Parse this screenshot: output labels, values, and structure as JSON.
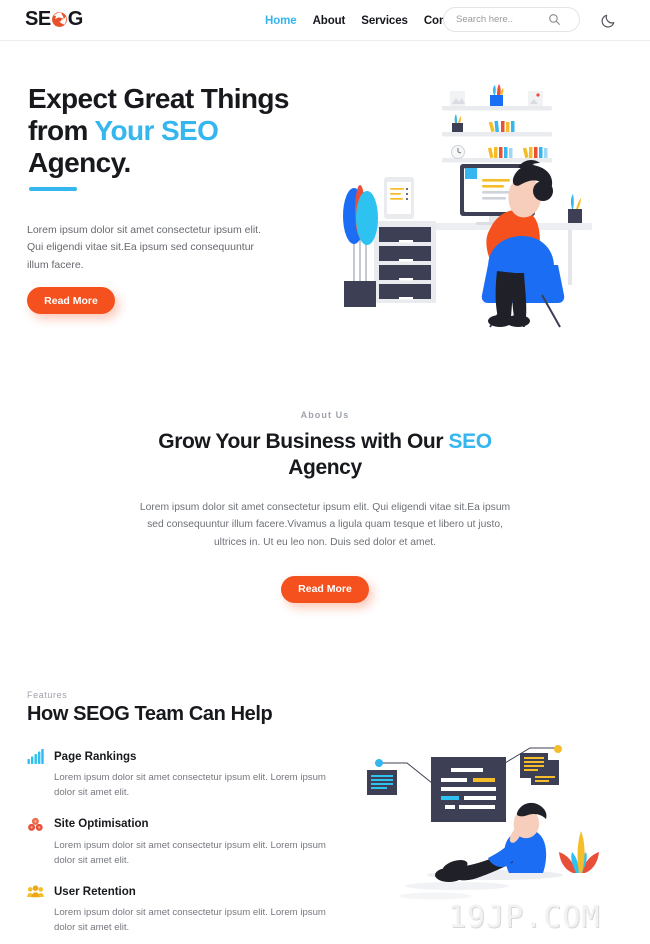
{
  "colors": {
    "accent_orange": "#f4511e",
    "accent_blue": "#35b6ef",
    "heading_dark": "#17191d",
    "body_gray": "#6e7178",
    "eyebrow_gray": "#9ea2ab",
    "background": "#ffffff",
    "icon_yellow": "#f5bd2a",
    "icon_red": "#e8503a",
    "illustration_dark": "#3d4054"
  },
  "header": {
    "logo": {
      "pre": "SE",
      "mark": "o-mark-icon",
      "post": "G",
      "full": "SEOG"
    },
    "nav": [
      {
        "label": "Home",
        "active": true
      },
      {
        "label": "About",
        "active": false
      },
      {
        "label": "Services",
        "active": false
      },
      {
        "label": "Contact",
        "active": false
      }
    ],
    "search": {
      "placeholder": "Search here..",
      "value": "",
      "icon": "search-icon"
    },
    "theme_toggle": {
      "icon": "moon-icon",
      "label": "Dark mode"
    }
  },
  "hero": {
    "title_line1": "Expect Great Things",
    "title_line2_plain": "from ",
    "title_line2_highlight": "Your SEO",
    "title_line3": "Agency.",
    "paragraph": "Lorem ipsum dolor sit amet consectetur ipsum elit. Qui eligendi vitae sit.Ea ipsum sed consequuntur illum facere.",
    "cta": "Read More",
    "illustration": "woman-at-desk-illustration"
  },
  "about": {
    "eyebrow": "About Us",
    "title_plain": "Grow Your Business with Our ",
    "title_highlight": "SEO",
    "title_tail": " Agency",
    "paragraph": "Lorem ipsum dolor sit amet consectetur ipsum elit. Qui eligendi vitae sit.Ea ipsum sed consequuntur illum facere.Vivamus a ligula quam tesque et libero ut justo, ultrices in. Ut eu leo non. Duis sed dolor et amet.",
    "cta": "Read More"
  },
  "features": {
    "eyebrow": "Features",
    "title": "How SEOG Team Can Help",
    "items": [
      {
        "icon": "bar-chart-icon",
        "name": "Page Rankings",
        "desc": "Lorem ipsum dolor sit amet consectetur ipsum elit. Lorem ipsum dolor sit amet elit."
      },
      {
        "icon": "molecule-icon",
        "name": "Site Optimisation",
        "desc": "Lorem ipsum dolor sit amet consectetur ipsum elit. Lorem ipsum dolor sit amet elit."
      },
      {
        "icon": "users-group-icon",
        "name": "User Retention",
        "desc": "Lorem ipsum dolor sit amet consectetur ipsum elit. Lorem ipsum dolor sit amet elit."
      }
    ],
    "illustration": "man-sitting-with-code-windows-illustration"
  },
  "watermark": {
    "text": "19JP.COM"
  }
}
